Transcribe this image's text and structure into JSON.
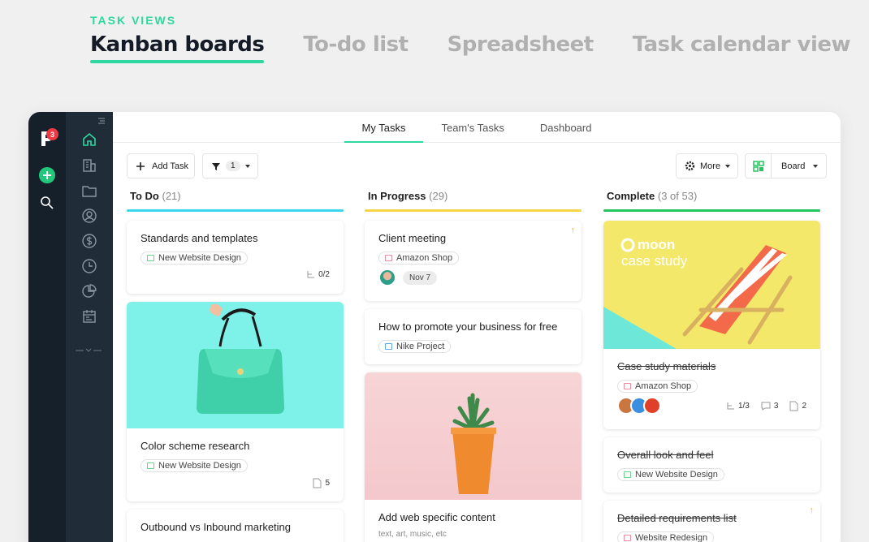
{
  "header": {
    "eyebrow": "TASK VIEWS",
    "views": [
      "Kanban boards",
      "To-do list",
      "Spreadsheet",
      "Task calendar view"
    ]
  },
  "app": {
    "badge_count": "3",
    "tabs": [
      "My Tasks",
      "Team's Tasks",
      "Dashboard"
    ],
    "toolbar": {
      "add_task": "Add Task",
      "filter_count": "1",
      "more": "More",
      "board": "Board"
    },
    "columns": [
      {
        "title": "To Do",
        "count": "(21)",
        "color": "#3ad6f0",
        "cards": [
          {
            "title": "Standards and templates",
            "tag": "New Website Design",
            "subtasks": "0/2"
          },
          {
            "title": "Color scheme research",
            "tag": "New Website Design",
            "files": "5"
          },
          {
            "title": "Outbound vs Inbound marketing"
          }
        ]
      },
      {
        "title": "In Progress",
        "count": "(29)",
        "color": "#f5d44a",
        "cards": [
          {
            "title": "Client meeting",
            "tag": "Amazon Shop",
            "date": "Nov 7"
          },
          {
            "title": "How to promote your business for free",
            "tag": "Nike Project"
          },
          {
            "title": "Add web specific content",
            "snippet": "text, art, music, etc"
          }
        ]
      },
      {
        "title": "Complete",
        "count": "(3 of 53)",
        "color": "#22c55e",
        "cards": [
          {
            "title": "Case study materials",
            "tag": "Amazon Shop",
            "subtasks": "1/3",
            "comments": "3",
            "files": "2",
            "image_brand": "moon",
            "image_text": "case study"
          },
          {
            "title": "Overall look and feel",
            "tag": "New Website Design"
          },
          {
            "title": "Detailed requirements list",
            "tag": "Website Redesign"
          }
        ]
      }
    ]
  },
  "colors": {
    "accent": "#2ed8a0",
    "rail": "#16202a",
    "sidebar": "#202c37"
  }
}
